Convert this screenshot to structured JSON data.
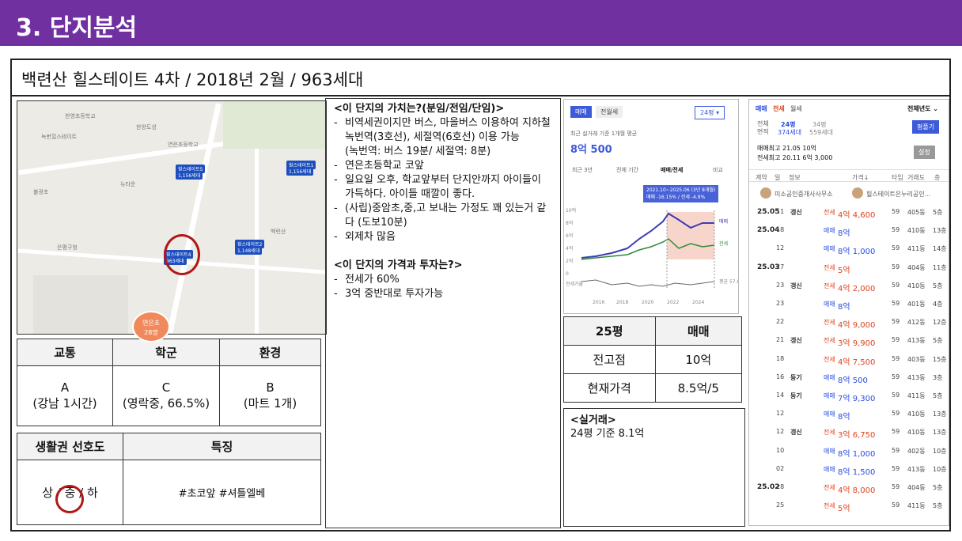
{
  "header": {
    "title": "3. 단지분석"
  },
  "complex": {
    "title": "백련산 힐스테이트 4차 / 2018년 2월 / 963세대"
  },
  "map": {
    "labels": [
      "한영초등학교",
      "한양도성",
      "녹번힐스테이트",
      "연은초등학교",
      "불광초",
      "힐스테이트5",
      "힐스테이트1",
      "힐스테이트2",
      "힐스테이트4",
      "뉴타운",
      "은평구청",
      "백련산"
    ],
    "badges": [
      "힐스테이트5",
      "1,156세대",
      "힐스테이트1",
      "1,156세대",
      "힐스테이트4",
      "963세대",
      "힐스테이트2",
      "1,148세대"
    ],
    "school": {
      "name": "연은초",
      "size": "28명"
    }
  },
  "grades": {
    "headers": [
      "교통",
      "학군",
      "환경"
    ],
    "values": [
      "A\n(강남 1시간)",
      "C\n(영락중, 66.5%)",
      "B\n(마트 1개)"
    ]
  },
  "prefs": {
    "header": "생활권 선호도",
    "feature_header": "특징",
    "scale": "상 / 중 / 하",
    "features": "#초코앞 #셔틀엘베"
  },
  "analysis": {
    "q1": "<이 단지의 가치는?(분임/전임/단임)>",
    "items": [
      "비역세권이지만 버스, 마을버스 이용하여 지하철 녹번역(3호선), 세절역(6호선) 이용 가능\n(녹번역: 버스 19분/ 세절역: 8분)",
      "연은초등학교 코앞",
      "일요일 오후, 학교앞부터 단지안까지 아이들이 가득하다. 아이들 때깔이 좋다.",
      "(사립)중암초,중,고 보내는 가정도 꽤 있는거 같다 (도보10분)",
      "외제차 많음"
    ],
    "q2": "<이 단지의 가격과 투자는?>",
    "items2": [
      "전세가 60%",
      "3억 중반대로 투자가능"
    ]
  },
  "chartpanel": {
    "tabs": [
      "매매",
      "전월세"
    ],
    "size": "24평",
    "subtitle": "최근 실거래 기준 1개월 평균",
    "price": "8억 500",
    "periods": [
      "최근 3년",
      "전체 기간",
      "매매/전세",
      "비교"
    ],
    "tooltip1": "2021.10~2025.06 (3년 8개월)",
    "tooltip2": "매매 -16.15% / 전세 -4.9%",
    "yticks": [
      "10억",
      "8억",
      "6억",
      "4억",
      "2억",
      "0"
    ],
    "xticks": [
      "2016",
      "2018",
      "2020",
      "2022",
      "2024"
    ],
    "legend": [
      "매매",
      "전세"
    ],
    "bottomlabel": "전세가율",
    "ratio": "평균\n57.8%",
    "colors": {
      "sale": "#3b3bb5",
      "jeonse": "#2e8b3a"
    }
  },
  "pricetable": {
    "h1": "25평",
    "h2": "매매",
    "r1": [
      "전고점",
      "10억"
    ],
    "r2": [
      "현재가격",
      "8.5억/5"
    ]
  },
  "real": {
    "title": "<실거래>",
    "text": "24평 기준 8.1억"
  },
  "listpanel": {
    "tabs": [
      "매매",
      "전세",
      "월세"
    ],
    "period": "전체년도 ⌄",
    "area_label": "전체\n면적",
    "area1": "24평",
    "area1b": "374세대",
    "area2": "34평",
    "area2b": "559세대",
    "compare": "평플기",
    "sale_high": "매매최고 21.05 10억",
    "jeonse_high": "전세최고 20.11 6억 3,000",
    "setting": "설정",
    "cols": [
      "계약",
      "일",
      "정보",
      "가격↓",
      "타입",
      "거래도",
      "층"
    ],
    "agents": [
      "미소공인중개사사무소",
      "힐스테이트은누리공인..."
    ],
    "rows": [
      {
        "ym": "25.05",
        "d": "11",
        "info": "갱신",
        "type": "전세",
        "price": "4억 4,600",
        "t": "59",
        "dong": "405동",
        "fl": "5층"
      },
      {
        "ym": "25.04",
        "d": "18",
        "info": "",
        "type": "매매",
        "price": "8억",
        "t": "59",
        "dong": "410동",
        "fl": "13층"
      },
      {
        "ym": "",
        "d": "12",
        "info": "",
        "type": "매매",
        "price": "8억 1,000",
        "t": "59",
        "dong": "411동",
        "fl": "14층"
      },
      {
        "ym": "25.03",
        "d": "27",
        "info": "",
        "type": "전세",
        "price": "5억",
        "t": "59",
        "dong": "404동",
        "fl": "11층"
      },
      {
        "ym": "",
        "d": "23",
        "info": "갱신",
        "type": "전세",
        "price": "4억 2,000",
        "t": "59",
        "dong": "410동",
        "fl": "5층"
      },
      {
        "ym": "",
        "d": "23",
        "info": "",
        "type": "매매",
        "price": "8억",
        "t": "59",
        "dong": "401동",
        "fl": "4층"
      },
      {
        "ym": "",
        "d": "22",
        "info": "",
        "type": "전세",
        "price": "4억 9,000",
        "t": "59",
        "dong": "412동",
        "fl": "12층"
      },
      {
        "ym": "",
        "d": "21",
        "info": "갱신",
        "type": "전세",
        "price": "3억 9,900",
        "t": "59",
        "dong": "413동",
        "fl": "5층"
      },
      {
        "ym": "",
        "d": "18",
        "info": "",
        "type": "전세",
        "price": "4억 7,500",
        "t": "59",
        "dong": "403동",
        "fl": "15층"
      },
      {
        "ym": "",
        "d": "16",
        "info": "등기",
        "type": "매매",
        "price": "8억 500",
        "t": "59",
        "dong": "413동",
        "fl": "3층"
      },
      {
        "ym": "",
        "d": "14",
        "info": "등기",
        "type": "매매",
        "price": "7억 9,300",
        "t": "59",
        "dong": "411동",
        "fl": "5층"
      },
      {
        "ym": "",
        "d": "12",
        "info": "",
        "type": "매매",
        "price": "8억",
        "t": "59",
        "dong": "410동",
        "fl": "13층"
      },
      {
        "ym": "",
        "d": "12",
        "info": "갱신",
        "type": "전세",
        "price": "3억 6,750",
        "t": "59",
        "dong": "410동",
        "fl": "13층"
      },
      {
        "ym": "",
        "d": "10",
        "info": "",
        "type": "매매",
        "price": "8억 1,000",
        "t": "59",
        "dong": "402동",
        "fl": "10층"
      },
      {
        "ym": "",
        "d": "02",
        "info": "",
        "type": "매매",
        "price": "8억 1,500",
        "t": "59",
        "dong": "413동",
        "fl": "10층"
      },
      {
        "ym": "25.02",
        "d": "28",
        "info": "",
        "type": "전세",
        "price": "4억 8,000",
        "t": "59",
        "dong": "404동",
        "fl": "5층"
      },
      {
        "ym": "",
        "d": "25",
        "info": "",
        "type": "전세",
        "price": "5억",
        "t": "59",
        "dong": "411동",
        "fl": "5층"
      }
    ]
  }
}
